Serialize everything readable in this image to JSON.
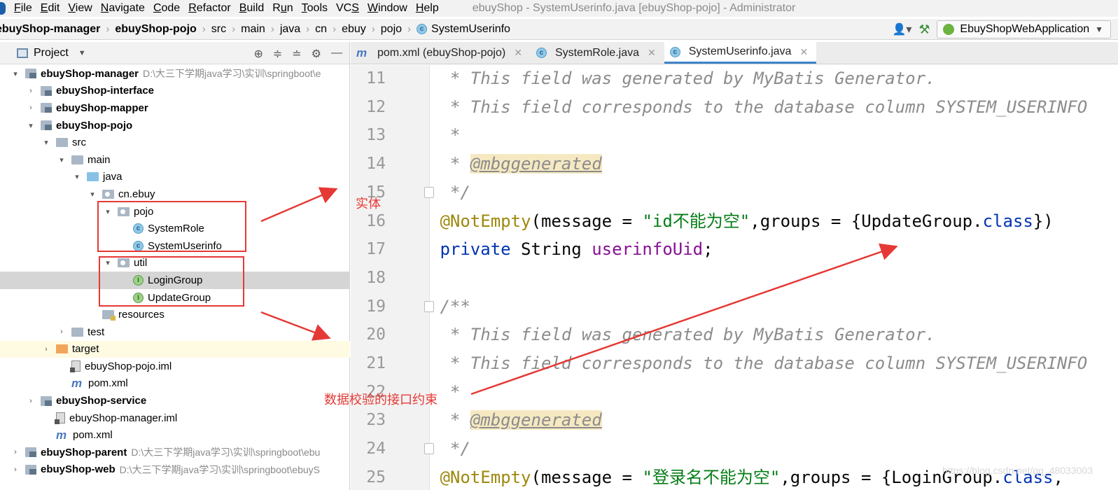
{
  "menu": {
    "items": [
      {
        "pre": "",
        "u": "F",
        "post": "ile"
      },
      {
        "pre": "",
        "u": "E",
        "post": "dit"
      },
      {
        "pre": "",
        "u": "V",
        "post": "iew"
      },
      {
        "pre": "",
        "u": "N",
        "post": "avigate"
      },
      {
        "pre": "",
        "u": "C",
        "post": "ode"
      },
      {
        "pre": "",
        "u": "R",
        "post": "efactor"
      },
      {
        "pre": "",
        "u": "B",
        "post": "uild"
      },
      {
        "pre": "R",
        "u": "u",
        "post": "n"
      },
      {
        "pre": "",
        "u": "T",
        "post": "ools"
      },
      {
        "pre": "VC",
        "u": "S",
        "post": ""
      },
      {
        "pre": "",
        "u": "W",
        "post": "indow"
      },
      {
        "pre": "",
        "u": "H",
        "post": "elp"
      }
    ],
    "window_title": "ebuyShop - SystemUserinfo.java [ebuyShop-pojo] - Administrator"
  },
  "breadcrumb": {
    "items": [
      "ebuyShop-manager",
      "ebuyShop-pojo",
      "src",
      "main",
      "java",
      "cn",
      "ebuy",
      "pojo",
      "SystemUserinfo"
    ],
    "bold_count": 2
  },
  "run_config": {
    "label": "EbuyShopWebApplication"
  },
  "project_panel": {
    "title": "Project",
    "rows": [
      {
        "indent": 0,
        "arrow": "▾",
        "icon": "module",
        "label": "ebuyShop-manager",
        "bold": true,
        "path": "D:\\大三下学期java学习\\实训\\springboot\\e"
      },
      {
        "indent": 1,
        "arrow": "›",
        "icon": "module",
        "label": "ebuyShop-interface",
        "bold": true
      },
      {
        "indent": 1,
        "arrow": "›",
        "icon": "module",
        "label": "ebuyShop-mapper",
        "bold": true
      },
      {
        "indent": 1,
        "arrow": "▾",
        "icon": "module",
        "label": "ebuyShop-pojo",
        "bold": true
      },
      {
        "indent": 2,
        "arrow": "▾",
        "icon": "folder",
        "label": "src"
      },
      {
        "indent": 3,
        "arrow": "▾",
        "icon": "folder",
        "label": "main"
      },
      {
        "indent": 4,
        "arrow": "▾",
        "icon": "folder-blue",
        "label": "java"
      },
      {
        "indent": 5,
        "arrow": "▾",
        "icon": "package",
        "label": "cn.ebuy"
      },
      {
        "indent": 6,
        "arrow": "▾",
        "icon": "package",
        "label": "pojo"
      },
      {
        "indent": 7,
        "arrow": "",
        "icon": "class",
        "label": "SystemRole"
      },
      {
        "indent": 7,
        "arrow": "",
        "icon": "class",
        "label": "SystemUserinfo"
      },
      {
        "indent": 6,
        "arrow": "▾",
        "icon": "package",
        "label": "util"
      },
      {
        "indent": 7,
        "arrow": "",
        "icon": "interface",
        "label": "LoginGroup",
        "selected": true
      },
      {
        "indent": 7,
        "arrow": "",
        "icon": "interface",
        "label": "UpdateGroup"
      },
      {
        "indent": 5,
        "arrow": "",
        "icon": "folder-res",
        "label": "resources"
      },
      {
        "indent": 3,
        "arrow": "›",
        "icon": "folder",
        "label": "test"
      },
      {
        "indent": 2,
        "arrow": "›",
        "icon": "folder-orange",
        "label": "target",
        "highlight": true
      },
      {
        "indent": 3,
        "arrow": "",
        "icon": "iml",
        "label": "ebuyShop-pojo.iml"
      },
      {
        "indent": 3,
        "arrow": "",
        "icon": "maven",
        "label": "pom.xml"
      },
      {
        "indent": 1,
        "arrow": "›",
        "icon": "module",
        "label": "ebuyShop-service",
        "bold": true
      },
      {
        "indent": 2,
        "arrow": "",
        "icon": "iml",
        "label": "ebuyShop-manager.iml"
      },
      {
        "indent": 2,
        "arrow": "",
        "icon": "maven",
        "label": "pom.xml"
      },
      {
        "indent": 0,
        "arrow": "›",
        "icon": "module",
        "label": "ebuyShop-parent",
        "bold": true,
        "path": "D:\\大三下学期java学习\\实训\\springboot\\ebu"
      },
      {
        "indent": 0,
        "arrow": "›",
        "icon": "module",
        "label": "ebuyShop-web",
        "bold": true,
        "path": "D:\\大三下学期java学习\\实训\\springboot\\ebuyS"
      }
    ]
  },
  "tabs": [
    {
      "label": "pom.xml (ebuyShop-pojo)",
      "icon": "maven",
      "active": false
    },
    {
      "label": "SystemRole.java",
      "icon": "class",
      "active": false
    },
    {
      "label": "SystemUserinfo.java",
      "icon": "class",
      "active": true
    }
  ],
  "code_lines": [
    {
      "num": "11",
      "tokens": [
        [
          "cmt",
          "  * This field was generated by MyBatis Generator."
        ]
      ]
    },
    {
      "num": "12",
      "tokens": [
        [
          "cmt",
          "  * This field corresponds to the database column SYSTEM_USERINFO"
        ]
      ]
    },
    {
      "num": "13",
      "tokens": [
        [
          "cmt",
          "  *"
        ]
      ]
    },
    {
      "num": "14",
      "tokens": [
        [
          "cmt",
          "  * "
        ],
        [
          "tag",
          "@mbggenerated"
        ]
      ]
    },
    {
      "num": "15",
      "tokens": [
        [
          "cmt",
          "  */"
        ]
      ],
      "fold": true
    },
    {
      "num": "16",
      "tokens": [
        [
          "anno",
          " @NotEmpty"
        ],
        [
          "plain",
          "(message = "
        ],
        [
          "str",
          "\"id不能为空\""
        ],
        [
          "plain",
          ",groups = {UpdateGroup."
        ],
        [
          "kw",
          "class"
        ],
        [
          "plain",
          "})"
        ]
      ]
    },
    {
      "num": "17",
      "tokens": [
        [
          "kw",
          " private"
        ],
        [
          "plain",
          " String "
        ],
        [
          "field",
          "userinfoUid"
        ],
        [
          "plain",
          ";"
        ]
      ]
    },
    {
      "num": "18",
      "tokens": []
    },
    {
      "num": "19",
      "tokens": [
        [
          "cmt",
          " /**"
        ]
      ],
      "fold": true
    },
    {
      "num": "20",
      "tokens": [
        [
          "cmt",
          "  * This field was generated by MyBatis Generator."
        ]
      ]
    },
    {
      "num": "21",
      "tokens": [
        [
          "cmt",
          "  * This field corresponds to the database column SYSTEM_USERINFO"
        ]
      ]
    },
    {
      "num": "22",
      "tokens": [
        [
          "cmt",
          "  *"
        ]
      ]
    },
    {
      "num": "23",
      "tokens": [
        [
          "cmt",
          "  * "
        ],
        [
          "tag",
          "@mbggenerated"
        ]
      ]
    },
    {
      "num": "24",
      "tokens": [
        [
          "cmt",
          "  */"
        ]
      ],
      "fold": true
    },
    {
      "num": "25",
      "tokens": [
        [
          "anno",
          " @NotEmpty"
        ],
        [
          "plain",
          "(message = "
        ],
        [
          "str",
          "\"登录名不能为空\""
        ],
        [
          "plain",
          ",groups = {LoginGroup."
        ],
        [
          "kw",
          "class"
        ],
        [
          "plain",
          ","
        ]
      ]
    }
  ],
  "annotations": {
    "entity_label": "实体",
    "interface_label": "数据校验的接口约束",
    "arrow_color": "#e53935"
  },
  "watermark": "https://blog.csdn.net/qq_48033003"
}
